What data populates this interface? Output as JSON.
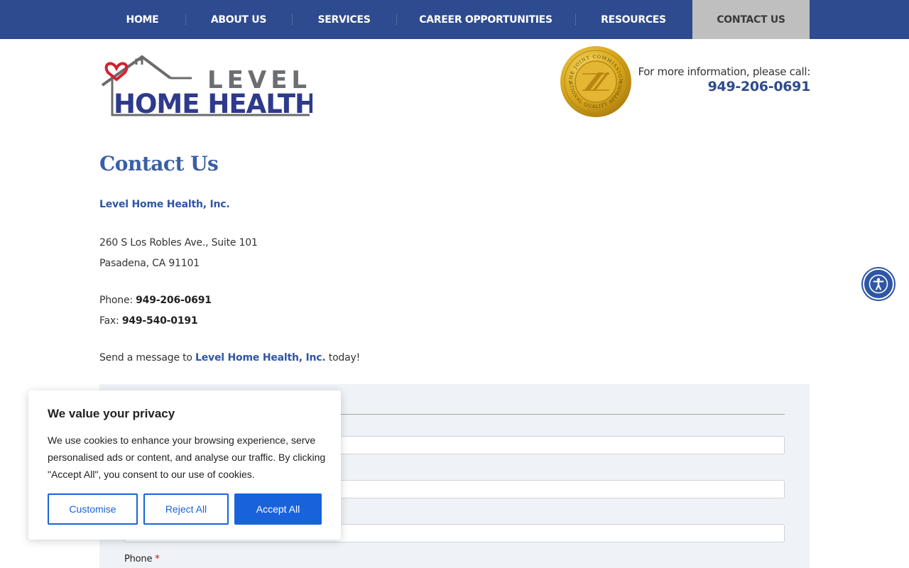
{
  "nav": {
    "items": [
      {
        "label": "HOME"
      },
      {
        "label": "ABOUT US"
      },
      {
        "label": "SERVICES"
      },
      {
        "label": "CAREER OPPORTUNITIES"
      },
      {
        "label": "RESOURCES"
      },
      {
        "label": "CONTACT US",
        "active": true
      }
    ]
  },
  "header": {
    "logo": {
      "line1": "LEVEL",
      "line2": "HOME HEALTH"
    },
    "seal": {
      "top_text": "THE JOINT COMMISSION",
      "bottom_text": "NATIONAL QUALITY APPROVAL"
    },
    "call_label": "For more information, please call:",
    "call_phone": "949-206-0691"
  },
  "main": {
    "title": "Contact Us",
    "company": "Level Home Health, Inc.",
    "address_line1": "260 S Los Robles Ave., Suite 101",
    "address_line2": "Pasadena, CA 91101",
    "phone_label": "Phone: ",
    "phone": "949-206-0691",
    "fax_label": "Fax: ",
    "fax": "949-540-0191",
    "message_prefix": "Send a message to ",
    "message_company": "Level Home Health, Inc.",
    "message_suffix": " today!"
  },
  "form": {
    "phone_label": "Phone",
    "required_mark": "*"
  },
  "cookie": {
    "title": "We value your privacy",
    "text": "We use cookies to enhance your browsing experience, serve personalised ads or content, and analyse our traffic. By clicking \"Accept All\", you consent to our use of cookies.",
    "customise": "Customise",
    "reject": "Reject All",
    "accept": "Accept All"
  },
  "colors": {
    "nav_bg": "#2e4b8f",
    "nav_active_bg": "#bfbfbf",
    "brand_blue": "#2e56a6",
    "cookie_accent": "#1863dc",
    "form_bg": "#eff2f6"
  },
  "icons": {
    "accessibility": "accessibility-person-icon"
  }
}
